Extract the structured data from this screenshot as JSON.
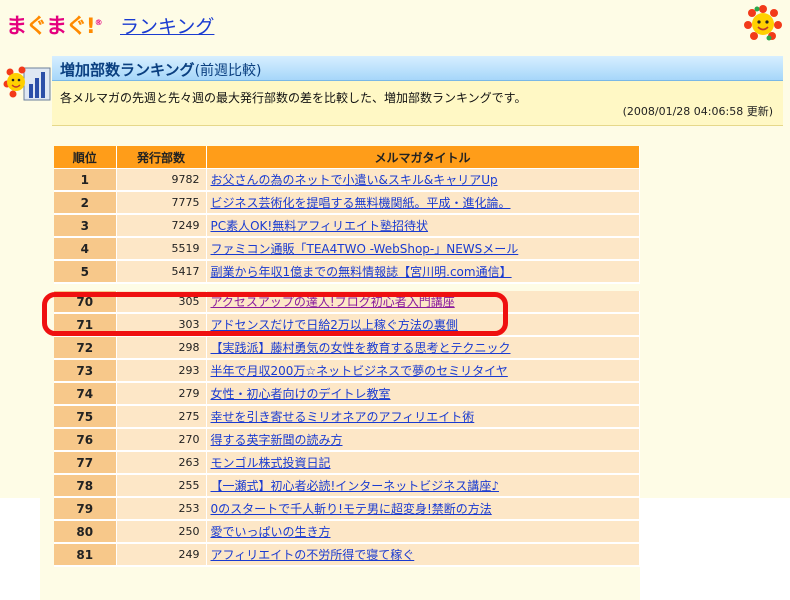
{
  "header": {
    "logo_parts": [
      "ま",
      "ぐ",
      "ま",
      "ぐ!"
    ],
    "logo_mark": "®",
    "link": "ランキング"
  },
  "section": {
    "title": "増加部数ランキング",
    "title_suffix": "(前週比較)",
    "description": "各メルマガの先週と先々週の最大発行部数の差を比較した、増加部数ランキングです。",
    "updated": "(2008/01/28 04:06:58 更新)"
  },
  "table": {
    "headers": [
      "順位",
      "発行部数",
      "メルマガタイトル"
    ],
    "top_rows": [
      {
        "rank": "1",
        "copies": "9782",
        "title": "お父さんの為のネットで小遣い&スキル&キャリアUp"
      },
      {
        "rank": "2",
        "copies": "7775",
        "title": "ビジネス芸術化を提唱する無料機関紙。平成・進化論。"
      },
      {
        "rank": "3",
        "copies": "7249",
        "title": "PC素人OK!無料アフィリエイト塾招待状"
      },
      {
        "rank": "4",
        "copies": "5519",
        "title": "ファミコン通販「TEA4TWO -WebShop-」NEWSメール"
      },
      {
        "rank": "5",
        "copies": "5417",
        "title": "副業から年収1億までの無料情報誌【宮川明.com通信】"
      }
    ],
    "lower_rows": [
      {
        "rank": "70",
        "copies": "305",
        "title": "アクセスアップの達人!ブログ初心者入門講座"
      },
      {
        "rank": "71",
        "copies": "303",
        "title": "アドセンスだけで日給2万以上稼ぐ方法の裏側"
      },
      {
        "rank": "72",
        "copies": "298",
        "title": "【実践派】藤村勇気の女性を教育する思考とテクニック"
      },
      {
        "rank": "73",
        "copies": "293",
        "title": "半年で月収200万☆ネットビジネスで夢のセミリタイヤ"
      },
      {
        "rank": "74",
        "copies": "279",
        "title": "女性・初心者向けのデイトレ教室"
      },
      {
        "rank": "75",
        "copies": "275",
        "title": "幸せを引き寄せるミリオネアのアフィリエイト術"
      },
      {
        "rank": "76",
        "copies": "270",
        "title": "得する英字新聞の読み方"
      },
      {
        "rank": "77",
        "copies": "263",
        "title": "モンゴル株式投資日記"
      },
      {
        "rank": "78",
        "copies": "255",
        "title": "【一瀬式】初心者必読!インターネットビジネス講座♪"
      },
      {
        "rank": "79",
        "copies": "253",
        "title": "0のスタートで千人斬り!モテ男に超変身!禁断の方法"
      },
      {
        "rank": "80",
        "copies": "250",
        "title": "愛でいっぱいの生き方"
      },
      {
        "rank": "81",
        "copies": "249",
        "title": "アフィリエイトの不労所得で寝て稼ぐ"
      }
    ]
  },
  "colors": {
    "header_orange": "#ff9d19",
    "rank_cell": "#f7c88a",
    "row_bg": "#fde7c7",
    "highlight_ring": "#ef1010",
    "link_blue": "#1a3bd1"
  },
  "icons": {
    "mascot": "sun-mascot-icon",
    "section": "ranking-chart-icon"
  }
}
